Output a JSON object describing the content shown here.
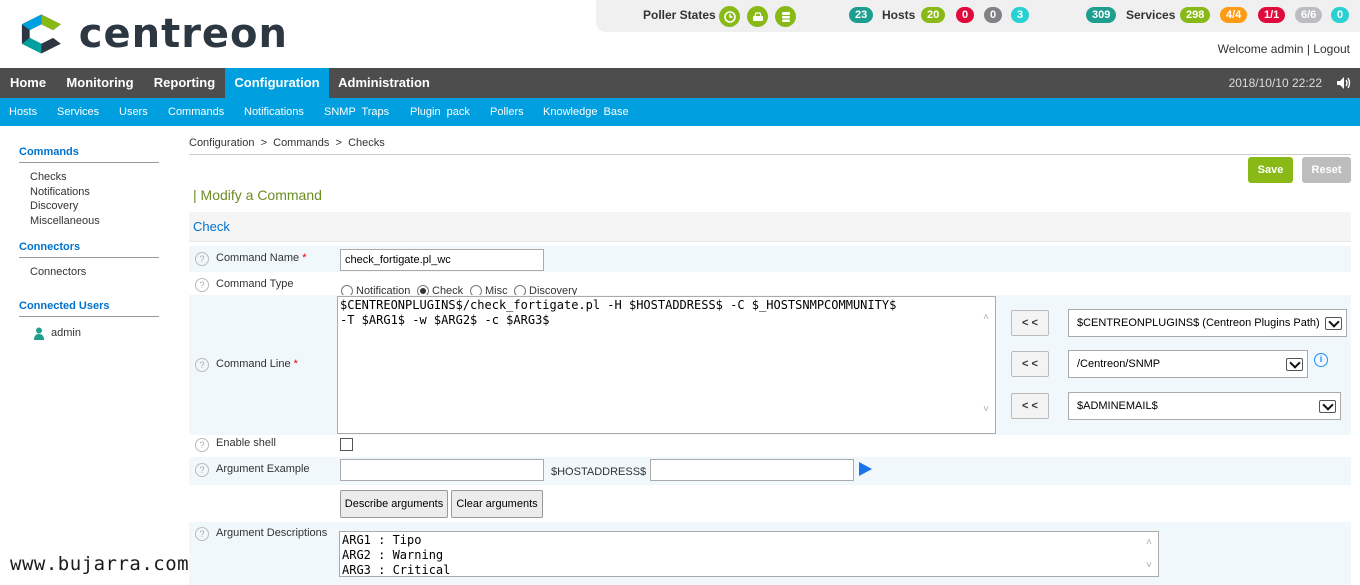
{
  "brand": {
    "name": "centreon"
  },
  "status": {
    "poller_label": "Poller States",
    "hosts_total": "23",
    "hosts_label": "Hosts",
    "hosts_up": "20",
    "hosts_down": "0",
    "hosts_unreach": "0",
    "hosts_pending": "3",
    "services_total": "309",
    "services_label": "Services",
    "svc_ok": "298",
    "svc_warning": "4/4",
    "svc_critical": "1/1",
    "svc_unknown": "6/6",
    "svc_pending": "0"
  },
  "user": {
    "welcome": "Welcome admin",
    "sep": "|",
    "logout": "Logout"
  },
  "nav": {
    "items": [
      "Home",
      "Monitoring",
      "Reporting",
      "Configuration",
      "Administration"
    ],
    "datetime": "2018/10/10 22:22"
  },
  "subnav": [
    "Hosts",
    "Services",
    "Users",
    "Commands",
    "Notifications",
    "SNMP Traps",
    "Plugin pack",
    "Pollers",
    "Knowledge Base"
  ],
  "sidebar": {
    "commands_title": "Commands",
    "commands_items": [
      "Checks",
      "Notifications",
      "Discovery",
      "Miscellaneous"
    ],
    "connectors_title": "Connectors",
    "connectors_items": [
      "Connectors"
    ],
    "users_title": "Connected Users",
    "users_items": [
      "admin"
    ]
  },
  "breadcrumb": {
    "a": "Configuration",
    "b": "Commands",
    "c": "Checks",
    "sep": ">"
  },
  "buttons": {
    "save": "Save",
    "reset": "Reset"
  },
  "form": {
    "title": "| Modify a Command",
    "section": "Check",
    "name_label": "Command Name",
    "name_value": "check_fortigate.pl_wc",
    "type_label": "Command Type",
    "types": [
      "Notification",
      "Check",
      "Misc",
      "Discovery"
    ],
    "type_selected": "Check",
    "line_label": "Command Line",
    "line_value": "$CENTREONPLUGINS$/check_fortigate.pl -H $HOSTADDRESS$ -C $_HOSTSNMPCOMMUNITY$\n-T $ARG1$ -w $ARG2$ -c $ARG3$",
    "insert_btn": "< <",
    "macro1": "$CENTREONPLUGINS$ (Centreon Plugins Path)",
    "macro2": "/Centreon/SNMP",
    "macro3": "$ADMINEMAIL$",
    "shell_label": "Enable shell",
    "arg_example_label": "Argument Example",
    "arg_example_value": "",
    "host_macro_label": "$HOSTADDRESS$",
    "host_macro_value": "",
    "describe_btn": "Describe arguments",
    "clear_btn": "Clear arguments",
    "desc_label": "Argument Descriptions",
    "desc_value": "ARG1 : Tipo\nARG2 : Warning\nARG3 : Critical"
  },
  "watermark": "www.bujarra.com"
}
